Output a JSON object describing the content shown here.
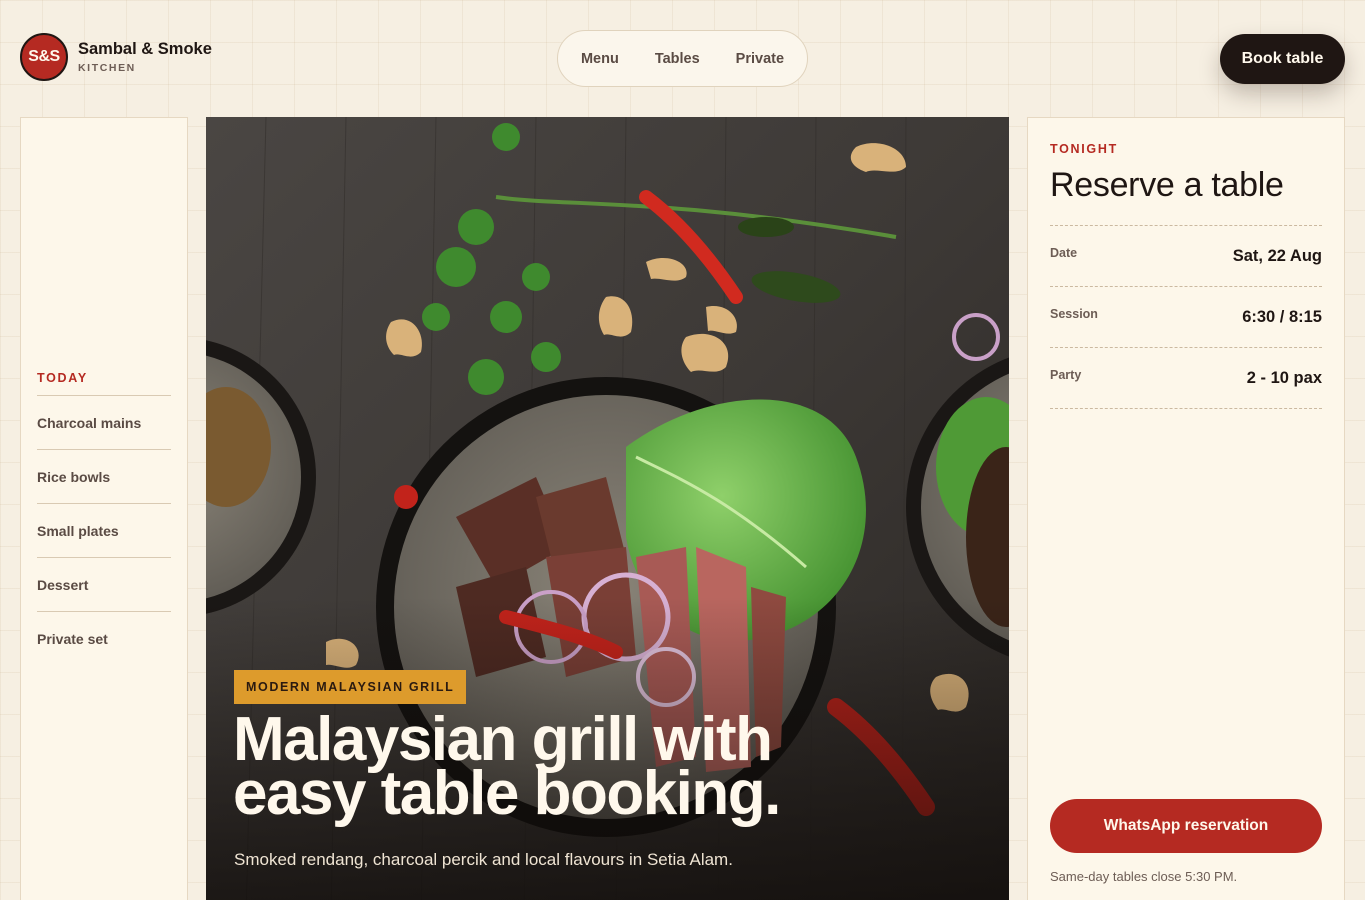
{
  "brand": {
    "badge": "S&S",
    "name": "Sambal & Smoke",
    "sub": "KITCHEN"
  },
  "nav": {
    "items": [
      "Menu",
      "Tables",
      "Private"
    ]
  },
  "header": {
    "book_label": "Book table"
  },
  "sidebar": {
    "heading": "TODAY",
    "items": [
      "Charcoal mains",
      "Rice bowls",
      "Small plates",
      "Dessert",
      "Private set"
    ]
  },
  "hero": {
    "tag": "MODERN MALAYSIAN GRILL",
    "title_line1": "Malaysian grill with",
    "title_line2": "easy table booking.",
    "subtitle": "Smoked rendang, charcoal percik and local flavours in Setia Alam."
  },
  "reservation": {
    "eyebrow": "TONIGHT",
    "title": "Reserve a table",
    "fields": [
      {
        "label": "Date",
        "value": "Sat, 22 Aug"
      },
      {
        "label": "Session",
        "value": "6:30 / 8:15"
      },
      {
        "label": "Party",
        "value": "2 - 10 pax"
      }
    ],
    "cta": "WhatsApp reservation",
    "note": "Same-day tables close 5:30 PM."
  },
  "colors": {
    "accent": "#b52a22",
    "dark": "#1f1613",
    "tag": "#dd9b2c",
    "background": "#f6efe2"
  },
  "icons": {
    "brand_badge": "logo-badge"
  }
}
